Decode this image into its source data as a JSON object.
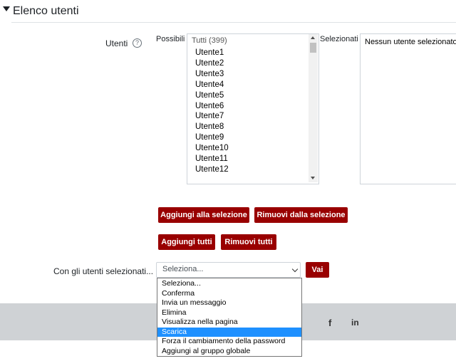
{
  "section": {
    "title": "Elenco utenti",
    "toggle_icon": "triangle-down-icon"
  },
  "utenti": {
    "label": "Utenti",
    "help_icon": "question-circle-icon",
    "help_glyph": "?",
    "possibili_label": "Possibili",
    "selezionati_label": "Selezionati",
    "available": {
      "group_label": "Tutti (399)",
      "items": [
        "Utente1",
        "Utente2",
        "Utente3",
        "Utente4",
        "Utente5",
        "Utente6",
        "Utente7",
        "Utente8",
        "Utente9",
        "Utente10",
        "Utente11",
        "Utente12"
      ]
    },
    "selected": {
      "empty_text": "Nessun utente selezionato"
    }
  },
  "buttons": {
    "add_selection": "Aggiungi alla selezione",
    "remove_selection": "Rimuovi dalla selezione",
    "add_all": "Aggiungi tutti",
    "remove_all": "Rimuovi tutti"
  },
  "bulk_action": {
    "label": "Con gli utenti selezionati...",
    "select_value": "Seleziona...",
    "go_label": "Vai",
    "options": [
      "Seleziona...",
      "Conferma",
      "Invia un messaggio",
      "Elimina",
      "Visualizza nella pagina",
      "Scarica",
      "Forza il cambiamento della password",
      "Aggiungi al gruppo globale"
    ],
    "highlighted_option": "Scarica"
  },
  "footer": {
    "facebook_glyph": "f",
    "linkedin_glyph": "in"
  },
  "colors": {
    "accent": "#990000",
    "highlight": "#1e90ff",
    "footer_bg": "#cfd2d5"
  }
}
